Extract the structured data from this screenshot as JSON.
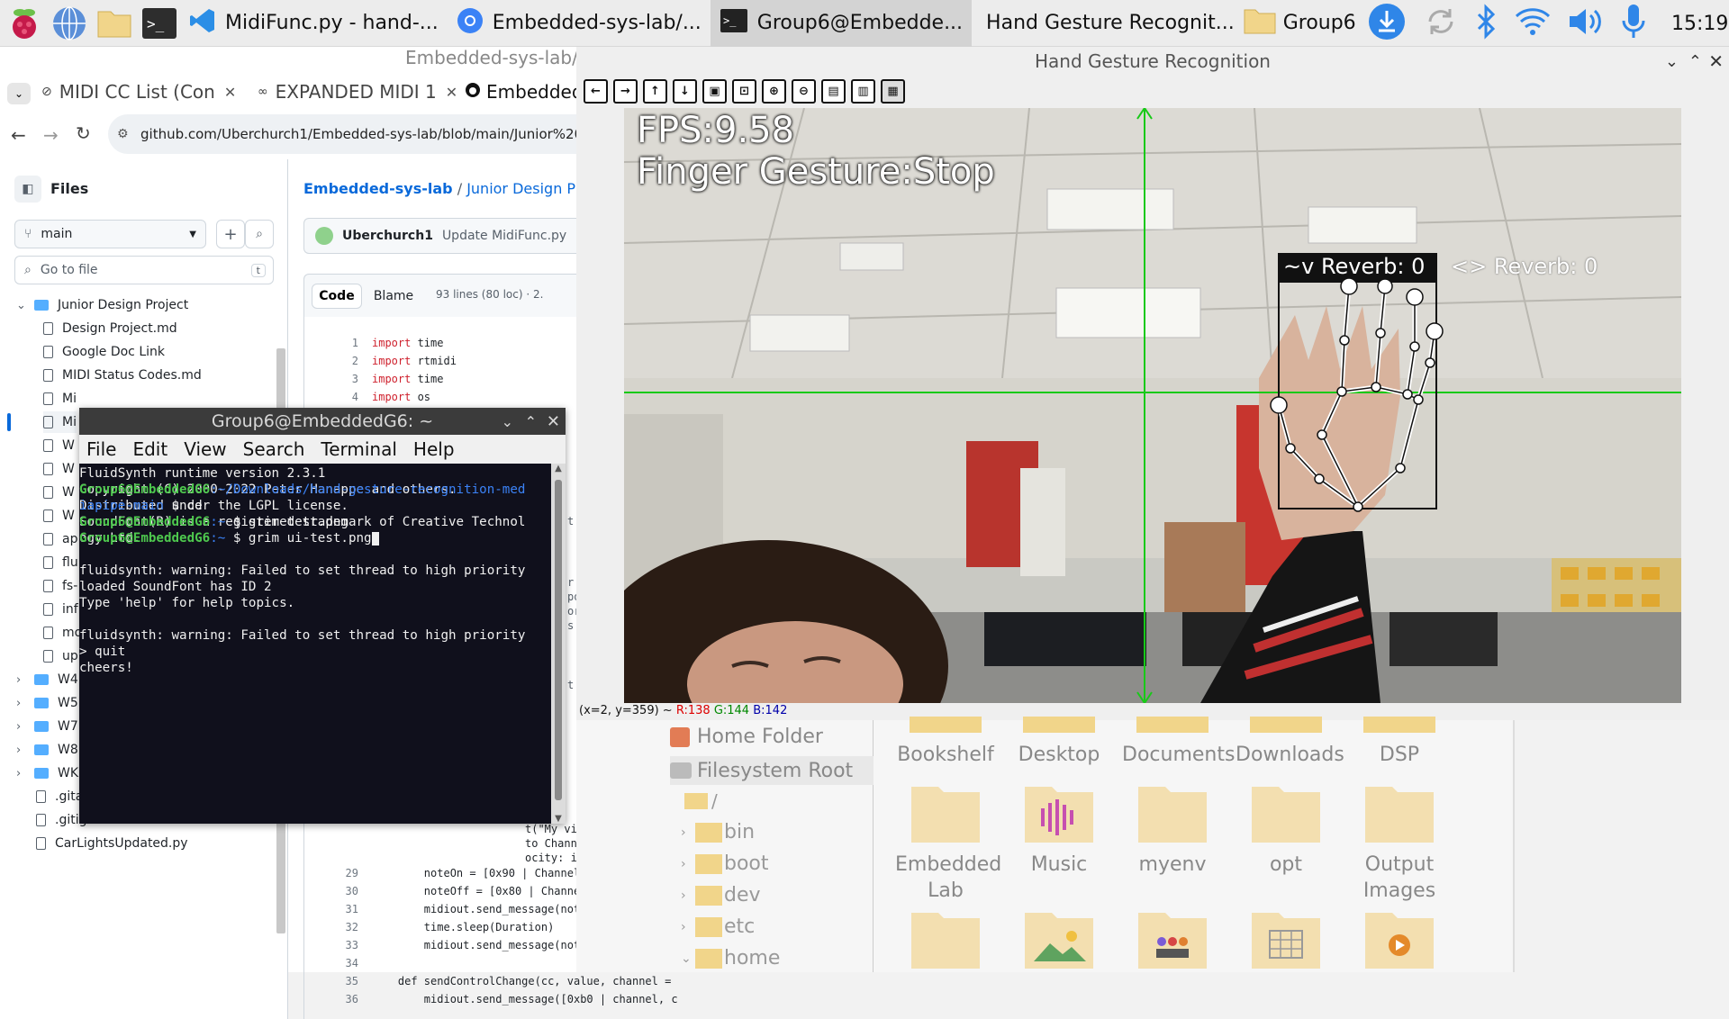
{
  "taskbar": {
    "tasks": [
      {
        "label": "MidiFunc.py - hand-..."
      },
      {
        "label": "Embedded-sys-lab/..."
      },
      {
        "label": "Group6@Embedde..."
      },
      {
        "label": "Hand Gesture Recognit..."
      },
      {
        "label": "Group6"
      }
    ],
    "clock": "15:19"
  },
  "browser": {
    "window_title": "Embedded-sys-lab/J",
    "tabs": [
      {
        "label": "MIDI CC List (Con"
      },
      {
        "label": "EXPANDED MIDI 1"
      },
      {
        "label": "Embedded"
      }
    ],
    "url": "github.com/Uberchurch1/Embedded-sys-lab/blob/main/Junior%20Design%20",
    "files_title": "Files",
    "branch": "main",
    "goto_placeholder": "Go to file",
    "goto_shortcut": "t",
    "tree": [
      {
        "label": "Junior Design Project",
        "type": "folder"
      },
      {
        "label": "Design Project.md",
        "type": "file"
      },
      {
        "label": "Google Doc Link",
        "type": "file"
      },
      {
        "label": "MIDI Status Codes.md",
        "type": "file"
      },
      {
        "label": "Mi",
        "type": "file"
      },
      {
        "label": "Mi",
        "type": "file"
      },
      {
        "label": "W",
        "type": "file"
      },
      {
        "label": "W",
        "type": "file"
      },
      {
        "label": "W",
        "type": "file"
      },
      {
        "label": "W",
        "type": "file"
      },
      {
        "label": "ap",
        "type": "file"
      },
      {
        "label": "flu",
        "type": "file"
      },
      {
        "label": "fs-",
        "type": "file"
      },
      {
        "label": "inf",
        "type": "file"
      },
      {
        "label": "mo",
        "type": "file"
      },
      {
        "label": "up",
        "type": "file"
      },
      {
        "label": "W4",
        "type": "folder"
      },
      {
        "label": "W5",
        "type": "folder"
      },
      {
        "label": "W7",
        "type": "folder"
      },
      {
        "label": "W8",
        "type": "folder"
      },
      {
        "label": "WK6",
        "type": "folder"
      },
      {
        "label": ".gitattributes",
        "type": "file"
      },
      {
        "label": ".gitignore",
        "type": "file"
      },
      {
        "label": "CarLightsUpdated.py",
        "type": "file"
      }
    ],
    "breadcrumb_repo": "Embedded-sys-lab",
    "breadcrumb_sep": "/",
    "breadcrumb_path": "Junior Design Projec",
    "commit_user": "Uberchurch1",
    "commit_msg": "Update MidiFunc.py",
    "code_tab": "Code",
    "blame_tab": "Blame",
    "lines_info": "93 lines (80 loc) · 2.",
    "code_top": [
      {
        "n": "1",
        "kw": "import",
        "rest": " time"
      },
      {
        "n": "2",
        "kw": "import",
        "rest": " rtmidi"
      },
      {
        "n": "3",
        "kw": "import",
        "rest": " time"
      },
      {
        "n": "4",
        "kw": "import",
        "rest": " os"
      },
      {
        "n": "5",
        "kw": "",
        "rest": ""
      }
    ],
    "code_frag": [
      "t",
      "r p",
      "po",
      "or",
      "s",
      "t",
      "t(\"My virtual o",
      "to Channel (wri",
      "ocity: int = 100"
    ],
    "code_bottom": [
      {
        "n": "29",
        "text": "        noteOn = [0x90 | Channel, Note, Velocit"
      },
      {
        "n": "30",
        "text": "        noteOff = [0x80 | Channel, Note, Veloci"
      },
      {
        "n": "31",
        "text": "        midiout.send_message(noteOn)"
      },
      {
        "n": "32",
        "text": "        time.sleep(Duration)"
      },
      {
        "n": "33",
        "text": "        midiout.send_message(noteOff)"
      },
      {
        "n": "34",
        "text": ""
      },
      {
        "n": "35",
        "text": "    def sendControlChange(cc, value, channel ="
      },
      {
        "n": "36",
        "text": "        midiout.send_message([0xb0 | channel, c"
      }
    ]
  },
  "terminal": {
    "title": "Group6@EmbeddedG6: ~",
    "menu": [
      "File",
      "Edit",
      "View",
      "Search",
      "Terminal",
      "Help"
    ],
    "lines": [
      "FluidSynth runtime version 2.3.1",
      "Copyright (C) 2000-2022 Peter Hanappe and others.",
      "Distributed under the LGPL license.",
      "SoundFont(R) is a registered trademark of Creative Technol",
      "ogy Ltd.",
      "",
      "fluidsynth: warning: Failed to set thread to high priority",
      "loaded SoundFont has ID 2",
      "Type 'help' for help topics.",
      "",
      "fluidsynth: warning: Failed to set thread to high priority",
      "> quit",
      "cheers!"
    ],
    "prompt_user": "Group6@EmbeddedG6",
    "prompt1_path": ":~/Downloads/hand-gesture-recognition-med",
    "prompt1_path2": "iapipe-main",
    "prompt1_cmd": " $ cd",
    "prompt2_path": ":~",
    "prompt2_cmd": " $ grim test.png",
    "prompt3_cmd": " $ grim ui-test.png"
  },
  "camera": {
    "title": "Hand Gesture Recognition",
    "fps": "FPS:9.58",
    "gesture": "Finger Gesture:Stop",
    "label1": "~v Reverb: 0",
    "label2": "<> Reverb: 0",
    "status_coords": "(x=2, y=359) ~",
    "status_r": "R:138",
    "status_g": "G:144",
    "status_b": "B:142"
  },
  "filemanager": {
    "places": [
      "Home Folder",
      "Filesystem Root"
    ],
    "root_label": "/",
    "tree": [
      "bin",
      "boot",
      "dev",
      "etc",
      "home"
    ],
    "row1": [
      "Bookshelf",
      "Desktop",
      "Documents",
      "Downloads",
      "DSP"
    ],
    "row2": [
      "Embedded Lab",
      "Music",
      "myenv",
      "opt",
      "Output Images"
    ]
  }
}
